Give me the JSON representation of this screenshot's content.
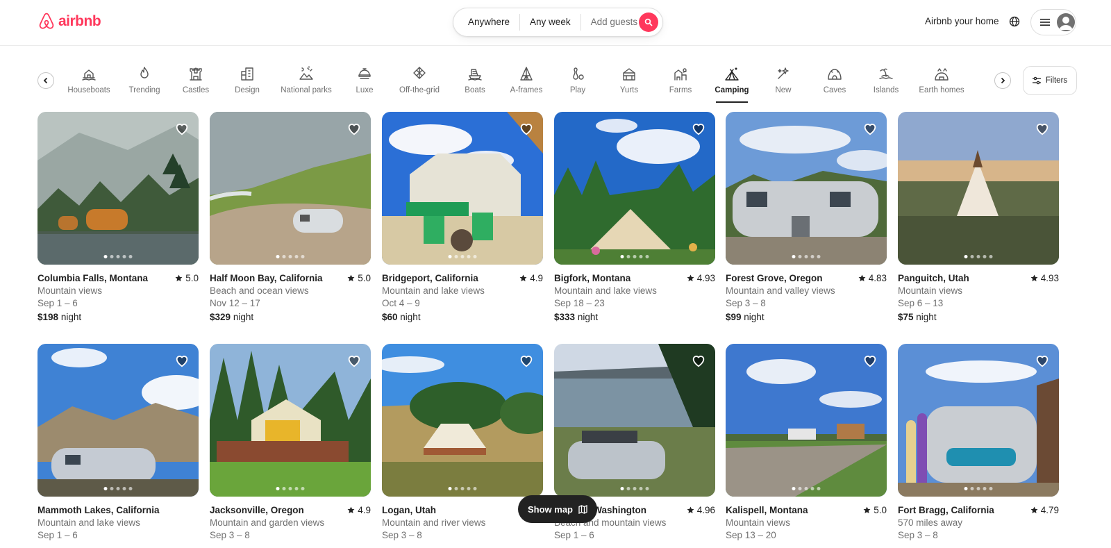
{
  "header": {
    "logo_text": "airbnb",
    "brand_color": "#ff385c",
    "search": {
      "where": "Anywhere",
      "when": "Any week",
      "who": "Add guests"
    },
    "host_link": "Airbnb your home"
  },
  "categories": {
    "items": [
      {
        "label": "Houseboats",
        "icon": "houseboat-icon"
      },
      {
        "label": "Trending",
        "icon": "flame-icon"
      },
      {
        "label": "Castles",
        "icon": "castle-icon"
      },
      {
        "label": "Design",
        "icon": "design-icon"
      },
      {
        "label": "National parks",
        "icon": "national-park-icon"
      },
      {
        "label": "Luxe",
        "icon": "luxe-icon"
      },
      {
        "label": "Off-the-grid",
        "icon": "off-grid-icon"
      },
      {
        "label": "Boats",
        "icon": "boat-icon"
      },
      {
        "label": "A-frames",
        "icon": "a-frame-icon"
      },
      {
        "label": "Play",
        "icon": "bowling-icon"
      },
      {
        "label": "Yurts",
        "icon": "yurt-icon"
      },
      {
        "label": "Farms",
        "icon": "farm-icon"
      },
      {
        "label": "Camping",
        "icon": "tent-icon",
        "active": true
      },
      {
        "label": "New",
        "icon": "new-icon"
      },
      {
        "label": "Caves",
        "icon": "cave-icon"
      },
      {
        "label": "Islands",
        "icon": "island-icon"
      },
      {
        "label": "Earth homes",
        "icon": "earth-home-icon"
      }
    ],
    "filters_label": "Filters"
  },
  "listings": [
    {
      "location": "Columbia Falls, Montana",
      "rating": "5.0",
      "desc": "Mountain views",
      "dates": "Sep 1 – 6",
      "price": "$198",
      "unit": "night"
    },
    {
      "location": "Half Moon Bay, California",
      "rating": "5.0",
      "desc": "Beach and ocean views",
      "dates": "Nov 12 – 17",
      "price": "$329",
      "unit": "night"
    },
    {
      "location": "Bridgeport, California",
      "rating": "4.9",
      "desc": "Mountain and lake views",
      "dates": "Oct 4 – 9",
      "price": "$60",
      "unit": "night"
    },
    {
      "location": "Bigfork, Montana",
      "rating": "4.93",
      "desc": "Mountain and lake views",
      "dates": "Sep 18 – 23",
      "price": "$333",
      "unit": "night"
    },
    {
      "location": "Forest Grove, Oregon",
      "rating": "4.83",
      "desc": "Mountain and valley views",
      "dates": "Sep 3 – 8",
      "price": "$99",
      "unit": "night"
    },
    {
      "location": "Panguitch, Utah",
      "rating": "4.93",
      "desc": "Mountain views",
      "dates": "Sep 6 – 13",
      "price": "$75",
      "unit": "night"
    },
    {
      "location": "Mammoth Lakes, California",
      "rating": "",
      "desc": "Mountain and lake views",
      "dates": "Sep 1 – 6"
    },
    {
      "location": "Jacksonville, Oregon",
      "rating": "4.9",
      "desc": "Mountain and garden views",
      "dates": "Sep 3 – 8"
    },
    {
      "location": "Logan, Utah",
      "rating": "",
      "desc": "Mountain and river views",
      "dates": "Sep 3 – 8"
    },
    {
      "location": "Sequim, Washington",
      "rating": "4.96",
      "desc": "Beach and mountain views",
      "dates": "Sep 1 – 6"
    },
    {
      "location": "Kalispell, Montana",
      "rating": "5.0",
      "desc": "Mountain views",
      "dates": "Sep 13 – 20"
    },
    {
      "location": "Fort Bragg, California",
      "rating": "4.79",
      "desc": "570 miles away",
      "dates": "Sep 3 – 8"
    }
  ],
  "show_map_label": "Show map"
}
